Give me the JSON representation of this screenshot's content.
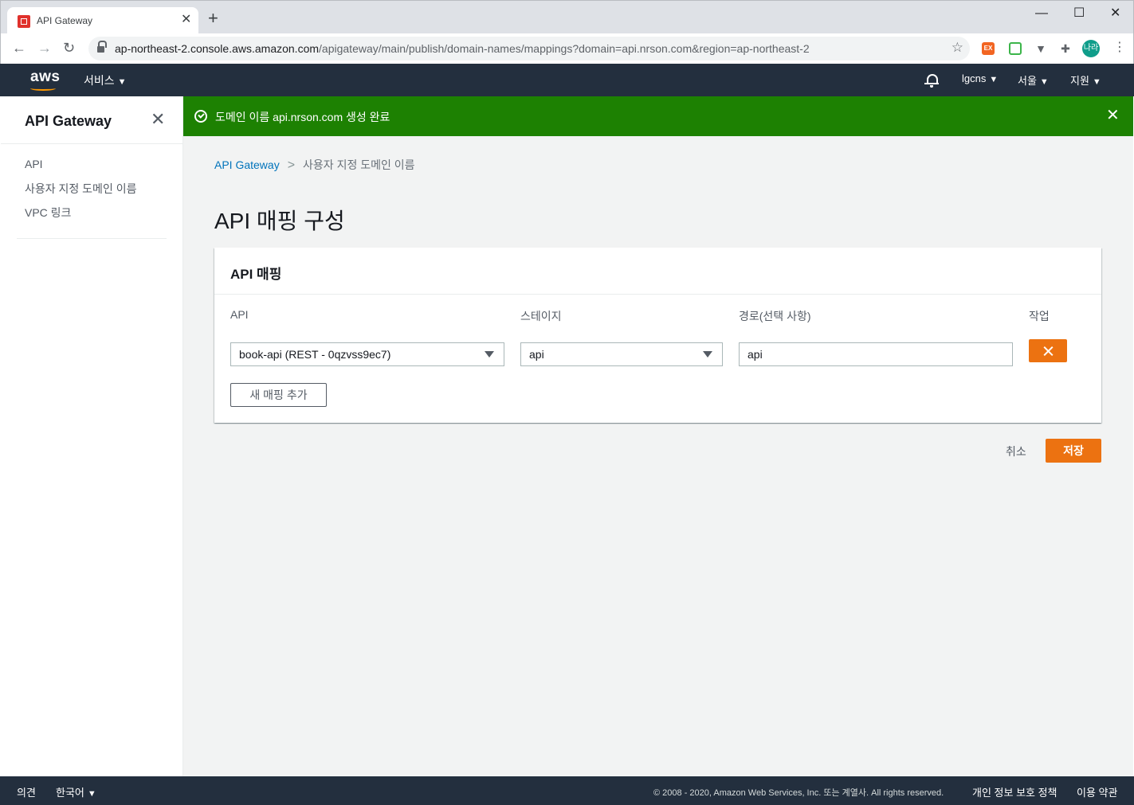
{
  "browser": {
    "tab_title": "API Gateway",
    "new_tab_symbol": "+",
    "url_host": "ap-northeast-2.console.aws.amazon.com",
    "url_path": "/apigateway/main/publish/domain-names/mappings?domain=api.nrson.com&region=ap-northeast-2",
    "profile_initials": "나라",
    "extensions": [
      "EX",
      "green-ext-icon",
      "vimeo-ext-icon",
      "puzzle-icon"
    ]
  },
  "aws_nav": {
    "logo": "aws",
    "services_label": "서비스",
    "account_label": "lgcns",
    "region_label": "서울",
    "support_label": "지원"
  },
  "sidebar": {
    "title": "API Gateway",
    "items": [
      {
        "label": "API"
      },
      {
        "label": "사용자 지정 도메인 이름"
      },
      {
        "label": "VPC 링크"
      }
    ]
  },
  "flash": {
    "message": "도메인 이름 api.nrson.com 생성 완료",
    "color": "#1d8102"
  },
  "breadcrumb": {
    "root": "API Gateway",
    "current": "사용자 지정 도메인 이름"
  },
  "page": {
    "title": "API 매핑 구성"
  },
  "mapping_panel": {
    "title": "API 매핑",
    "columns": {
      "api": "API",
      "stage": "스테이지",
      "path": "경로(선택 사항)",
      "action": "작업"
    },
    "rows": [
      {
        "api": "book-api (REST - 0qzvss9ec7)",
        "stage": "api",
        "path": "api"
      }
    ],
    "add_button": "새 매핑 추가"
  },
  "actions": {
    "cancel": "취소",
    "save": "저장",
    "accent_color": "#ec7211"
  },
  "footer": {
    "feedback": "의견",
    "language": "한국어",
    "copyright": "© 2008 - 2020, Amazon Web Services, Inc. 또는 계열사. All rights reserved.",
    "privacy": "개인 정보 보호 정책",
    "terms": "이용 약관"
  }
}
